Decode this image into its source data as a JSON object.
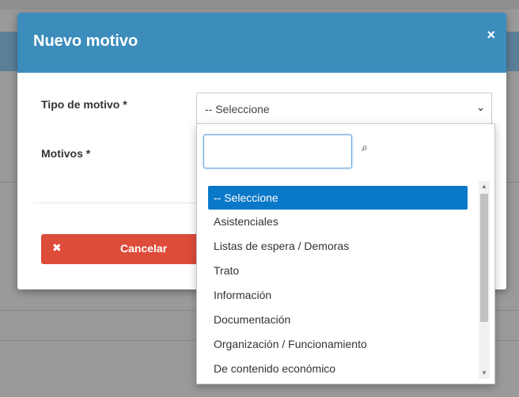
{
  "modal": {
    "title": "Nuevo motivo",
    "close_icon": "×",
    "fields": {
      "tipo_label": "Tipo de motivo *",
      "motivos_label": "Motivos *",
      "tipo_value": "-- Seleccione"
    },
    "cancel_label": "Cancelar"
  },
  "dropdown": {
    "search_value": "",
    "options": [
      "-- Seleccione",
      "Asistenciales",
      "Listas de espera / Demoras",
      "Trato",
      "Información",
      "Documentación",
      "Organización / Funcionamiento",
      "De contenido económico"
    ],
    "selected_index": 0
  },
  "colors": {
    "header": "#3c8dbc",
    "cancel": "#dd4b39",
    "selected_option": "#0a78c8"
  }
}
